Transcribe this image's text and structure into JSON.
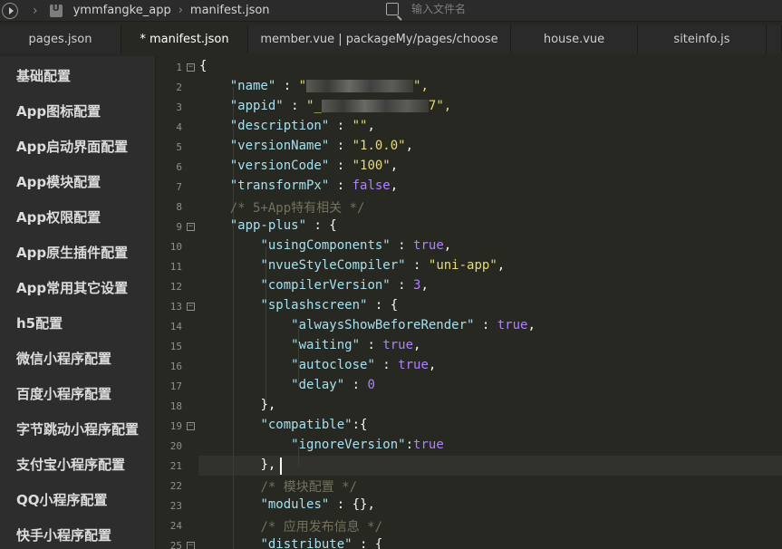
{
  "topbar": {
    "project": "ymmfangke_app",
    "file": "manifest.json",
    "search_placeholder": "输入文件名"
  },
  "tabs": [
    {
      "label": "pages.json"
    },
    {
      "label": "* manifest.json"
    },
    {
      "label": "member.vue | packageMy/pages/choose"
    },
    {
      "label": "house.vue"
    },
    {
      "label": "siteinfo.js"
    }
  ],
  "sidebar": {
    "items": [
      {
        "label": "基础配置"
      },
      {
        "label": "App图标配置"
      },
      {
        "label": "App启动界面配置"
      },
      {
        "label": "App模块配置"
      },
      {
        "label": "App权限配置"
      },
      {
        "label": "App原生插件配置"
      },
      {
        "label": "App常用其它设置"
      },
      {
        "label": "h5配置"
      },
      {
        "label": "微信小程序配置"
      },
      {
        "label": "百度小程序配置"
      },
      {
        "label": "字节跳动小程序配置"
      },
      {
        "label": "支付宝小程序配置"
      },
      {
        "label": "QQ小程序配置"
      },
      {
        "label": "快手小程序配置"
      }
    ]
  },
  "editor": {
    "line_numbers": [
      "1",
      "2",
      "3",
      "4",
      "5",
      "6",
      "7",
      "8",
      "9",
      "10",
      "11",
      "12",
      "13",
      "14",
      "15",
      "16",
      "17",
      "18",
      "19",
      "20",
      "21",
      "22",
      "23",
      "24",
      "25"
    ],
    "code": {
      "l1": "{",
      "l2_key": "\"name\"",
      "l2_sep": " : ",
      "l2_val_start": "\"",
      "l2_val_end": "\",",
      "l3_key": "\"appid\"",
      "l3_sep": " : ",
      "l3_val_start": "\"_",
      "l3_val_end": "7\",",
      "l4_key": "\"description\"",
      "l4_sep": " : ",
      "l4_val": "\"\"",
      "l4_end": ",",
      "l5_key": "\"versionName\"",
      "l5_sep": " : ",
      "l5_val": "\"1.0.0\"",
      "l5_end": ",",
      "l6_key": "\"versionCode\"",
      "l6_sep": " : ",
      "l6_val": "\"100\"",
      "l6_end": ",",
      "l7_key": "\"transformPx\"",
      "l7_sep": " : ",
      "l7_val": "false",
      "l7_end": ",",
      "l8": "/* 5+App特有相关 */",
      "l9_key": "\"app-plus\"",
      "l9_end": " : {",
      "l10_key": "\"usingComponents\"",
      "l10_sep": " : ",
      "l10_val": "true",
      "l10_end": ",",
      "l11_key": "\"nvueStyleCompiler\"",
      "l11_sep": " : ",
      "l11_val": "\"uni-app\"",
      "l11_end": ",",
      "l12_key": "\"compilerVersion\"",
      "l12_sep": " : ",
      "l12_val": "3",
      "l12_end": ",",
      "l13_key": "\"splashscreen\"",
      "l13_end": " : {",
      "l14_key": "\"alwaysShowBeforeRender\"",
      "l14_sep": " : ",
      "l14_val": "true",
      "l14_end": ",",
      "l15_key": "\"waiting\"",
      "l15_sep": " : ",
      "l15_val": "true",
      "l15_end": ",",
      "l16_key": "\"autoclose\"",
      "l16_sep": " : ",
      "l16_val": "true",
      "l16_end": ",",
      "l17_key": "\"delay\"",
      "l17_sep": " : ",
      "l17_val": "0",
      "l18": "},",
      "l19_key": "\"compatible\"",
      "l19_end": ":{",
      "l20_key": "\"ignoreVersion\"",
      "l20_sep": ":",
      "l20_val": "true",
      "l21": "},",
      "l22": "/* 模块配置 */",
      "l23_key": "\"modules\"",
      "l23_end": " : {},",
      "l24": "/* 应用发布信息 */",
      "l25_key": "\"distribute\"",
      "l25_end": " : {"
    }
  },
  "colors": {
    "editor_bg": "#272822",
    "key": "#a6e0ef",
    "string": "#e6db74",
    "number": "#ae81ff",
    "comment": "#75715e"
  }
}
